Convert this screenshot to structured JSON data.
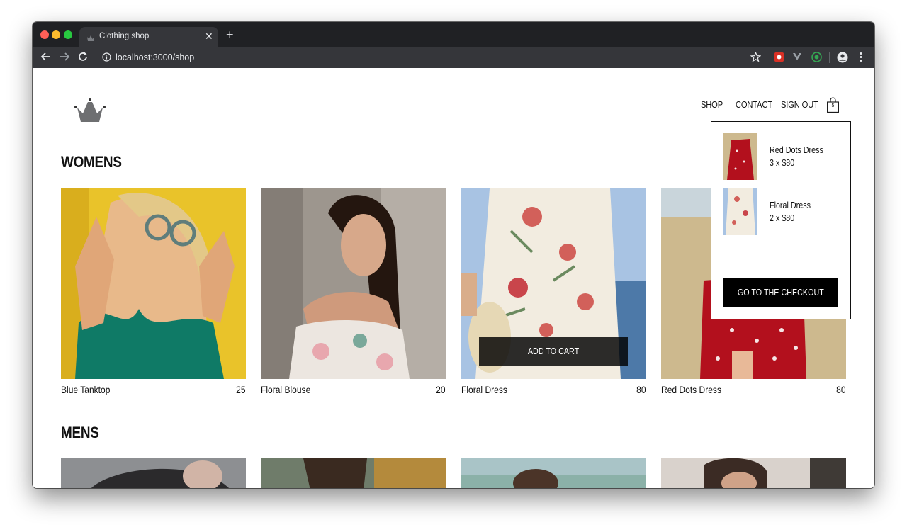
{
  "browser": {
    "tab_title": "Clothing shop",
    "url": "localhost:3000/shop",
    "traffic_colors": [
      "#ff5f57",
      "#febc2e",
      "#28c840"
    ]
  },
  "header": {
    "logo_icon": "crown-icon",
    "nav": [
      "SHOP",
      "CONTACT",
      "SIGN OUT"
    ],
    "bag_icon": "shopping-bag-icon",
    "bag_count": "5"
  },
  "womens": {
    "title": "WOMENS",
    "items": [
      {
        "name": "Blue Tanktop",
        "price": "25"
      },
      {
        "name": "Floral Blouse",
        "price": "20"
      },
      {
        "name": "Floral Dress",
        "price": "80"
      },
      {
        "name": "Red Dots Dress",
        "price": "80"
      }
    ],
    "add_to_cart_label": "ADD TO CART"
  },
  "mens": {
    "title": "MENS"
  },
  "cart_dropdown": {
    "items": [
      {
        "name": "Red Dots Dress",
        "qty": "3 x $80"
      },
      {
        "name": "Floral Dress",
        "qty": "2 x $80"
      }
    ],
    "checkout_label": "GO TO THE CHECKOUT"
  }
}
